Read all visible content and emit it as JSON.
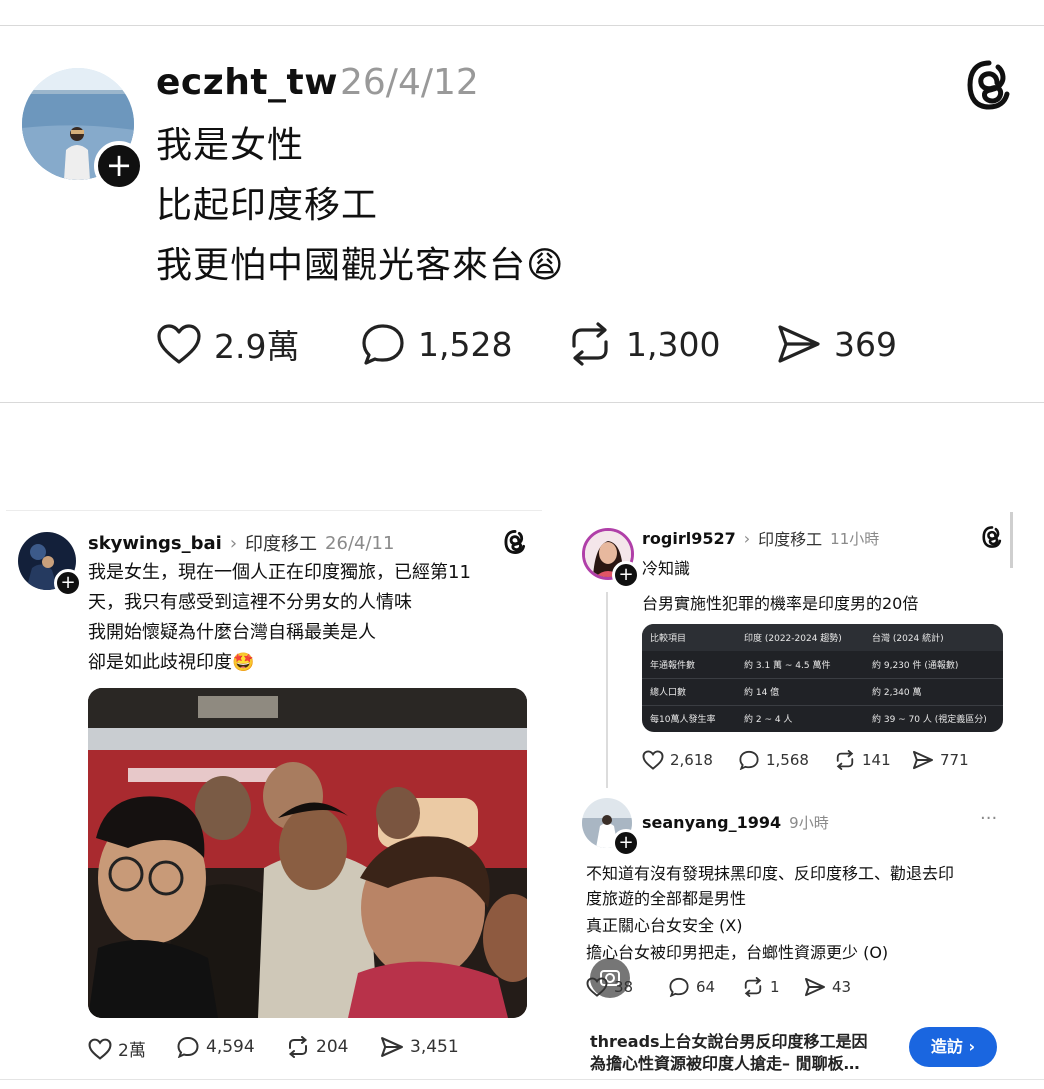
{
  "main_post": {
    "username": "eczht_tw",
    "date": "26/4/12",
    "lines": [
      "我是女性",
      "比起印度移工",
      "我更怕中國觀光客來台😩"
    ],
    "stats": {
      "likes": "2.9萬",
      "replies": "1,528",
      "reposts": "1,300",
      "shares": "369"
    }
  },
  "left_post": {
    "username": "skywings_bai",
    "topic": "印度移工",
    "date": "26/4/11",
    "lines": [
      "我是女生，現在一個人正在印度獨旅，已經第11",
      "天，我只有感受到這裡不分男女的人情味",
      "我開始懷疑為什麼台灣自稱最美是人",
      "卻是如此歧視印度🤩"
    ],
    "stats": {
      "likes": "2萬",
      "replies": "4,594",
      "reposts": "204",
      "shares": "3,451"
    }
  },
  "right_post": {
    "username": "rogirl9527",
    "topic": "印度移工",
    "time": "11小時",
    "subtitle": "冷知識",
    "line": "台男實施性犯罪的機率是印度男的20倍",
    "table": {
      "headers": [
        "比較項目",
        "印度 (2022-2024 趨勢)",
        "台灣 (2024 統計)"
      ],
      "rows": [
        [
          "年通報件數",
          "約 3.1 萬 ~ 4.5 萬件",
          "約 9,230 件 (通報數)"
        ],
        [
          "總人口數",
          "約 14 億",
          "約 2,340 萬"
        ],
        [
          "每10萬人發生率",
          "約 2 ~ 4 人",
          "約 39 ~ 70 人 (視定義區分)"
        ]
      ]
    },
    "stats": {
      "likes": "2,618",
      "replies": "1,568",
      "reposts": "141",
      "shares": "771"
    }
  },
  "reply_post": {
    "username": "seanyang_1994",
    "time": "9小時",
    "more": "···",
    "lines": [
      "不知道有沒有發現抹黑印度、反印度移工、勸退去印",
      "度旅遊的全部都是男性",
      "真正關心台女安全 (X)",
      "擔心台女被印男把走，台螂性資源更少 (O)"
    ],
    "stats": {
      "likes": "38",
      "replies": "64",
      "reposts": "1",
      "shares": "43"
    }
  },
  "footer": {
    "title_line1": "threads上台女說台男反印度移工是因",
    "title_line2": "為擔心性資源被印度人搶走– 閒聊板…",
    "visit_label": "造訪 ›"
  }
}
